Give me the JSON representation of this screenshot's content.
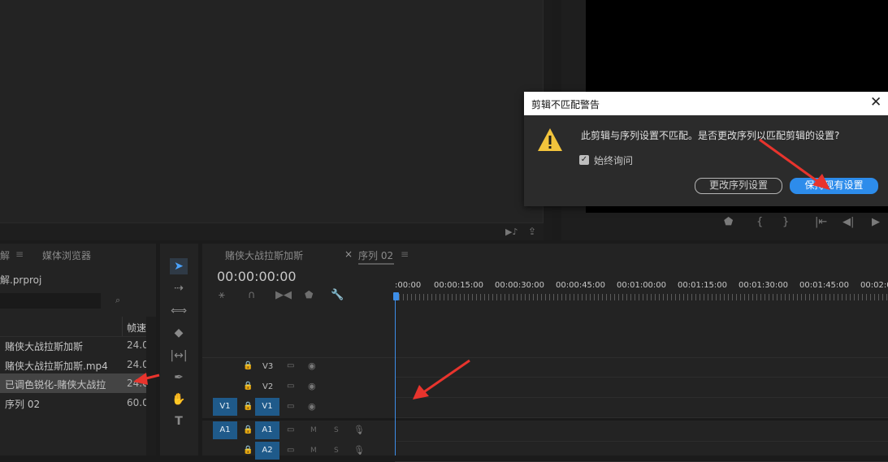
{
  "source_monitor": {},
  "program_monitor": {
    "controls": [
      "marker-icon",
      "mark-in-icon",
      "mark-out-icon",
      "go-to-in-icon",
      "step-back-icon",
      "play-icon"
    ]
  },
  "project": {
    "tab_project": "解",
    "tab_media_browser": "媒体浏览器",
    "project_file": "解.prproj",
    "column_fps": "帧速",
    "items": [
      {
        "name": "赌侠大战拉斯加斯",
        "fps": "24.00"
      },
      {
        "name": "赌侠大战拉斯加斯.mp4",
        "fps": "24.00"
      },
      {
        "name": "已调色锐化-赌侠大战拉",
        "fps": "24.0"
      },
      {
        "name": "序列 02",
        "fps": "60.00"
      }
    ]
  },
  "timeline": {
    "tab_sequence_a": "赌侠大战拉斯加斯",
    "tab_sequence_b": "序列 02",
    "timecode": "00:00:00:00",
    "ruler_labels": [
      ":00:00",
      "00:00:15:00",
      "00:00:30:00",
      "00:00:45:00",
      "00:01:00:00",
      "00:01:15:00",
      "00:01:30:00",
      "00:01:45:00",
      "00:02:0"
    ],
    "tracks": {
      "v3": "V3",
      "v2": "V2",
      "v1_source": "V1",
      "v1": "V1",
      "a1_source": "A1",
      "a1": "A1",
      "a2": "A2",
      "mute": "M",
      "solo": "S"
    }
  },
  "dialog": {
    "title": "剪辑不匹配警告",
    "message": "此剪辑与序列设置不匹配。是否更改序列以匹配剪辑的设置?",
    "checkbox_label": "始终询问",
    "checkbox_checked": true,
    "btn_change": "更改序列设置",
    "btn_keep": "保持现有设置",
    "accent": "#2d8ceb",
    "warning_color": "#f2c43c"
  },
  "annotation_color": "#e8342d"
}
